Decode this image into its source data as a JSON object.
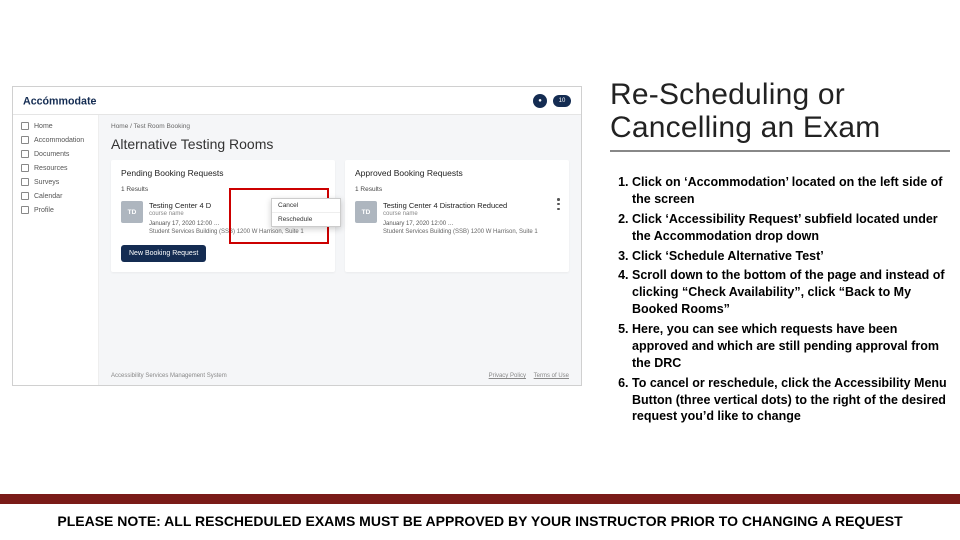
{
  "slide": {
    "title": "Re-Scheduling or Cancelling an Exam",
    "note": "PLEASE NOTE: ALL RESCHEDULED EXAMS MUST BE APPROVED BY YOUR INSTRUCTOR PRIOR TO CHANGING A REQUEST"
  },
  "steps": [
    "Click on ‘Accommodation’ located on the left side of the screen",
    "Click ‘Accessibility Request’ subfield located under the Accommodation drop down",
    "Click ‘Schedule Alternative Test’",
    "Scroll down to the bottom of the page and instead of clicking “Check Availability”, click “Back to My Booked Rooms”",
    "Here, you can see which requests have been approved and which are still pending approval from the DRC",
    "To cancel or reschedule, click the Accessibility Menu Button (three vertical dots) to the right of the desired request you’d like to change"
  ],
  "app": {
    "logo_text": "Accómmodate",
    "header": {
      "badge": "10",
      "avatar": "●"
    },
    "sidebar": [
      "Home",
      "Accommodation",
      "Documents",
      "Resources",
      "Surveys",
      "Calendar",
      "Profile"
    ],
    "breadcrumb": "Home / Test Room Booking",
    "page_title": "Alternative Testing Rooms",
    "cards": {
      "pending": {
        "title": "Pending Booking Requests",
        "results": "1 Results",
        "entry": {
          "icon": "TD",
          "name": "Testing Center 4 D",
          "subtitle": "course name",
          "date": "January 17, 2020 12:00 …",
          "location": "Student Services Building (SSB) 1200 W Harrison, Suite 1"
        },
        "menu": {
          "cancel": "Cancel",
          "reschedule": "Reschedule"
        },
        "new_booking": "New Booking Request"
      },
      "approved": {
        "title": "Approved Booking Requests",
        "results": "1 Results",
        "entry": {
          "icon": "TD",
          "name": "Testing Center 4 Distraction Reduced",
          "subtitle": "course name",
          "date": "January 17, 2020 12:00 …",
          "location": "Student Services Building (SSB) 1200 W Harrison, Suite 1"
        }
      }
    },
    "footer": {
      "left": "Accessibility Services Management System",
      "privacy": "Privacy Policy",
      "terms": "Terms of Use"
    }
  }
}
